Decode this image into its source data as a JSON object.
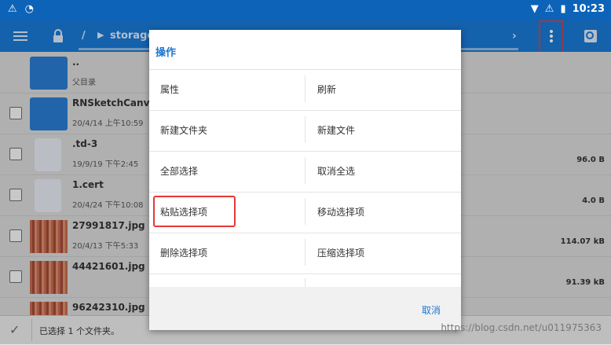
{
  "statusbar": {
    "time": "10:23"
  },
  "toolbar": {
    "path_root": "/",
    "path_segment": "storage"
  },
  "list": {
    "rows": [
      {
        "name": "..",
        "meta": "父目录",
        "size": ""
      },
      {
        "name": "RNSketchCanvas",
        "meta": "20/4/14 上午10:59",
        "size": ""
      },
      {
        "name": ".td-3",
        "meta": "19/9/19 下午2:45",
        "size": "96.0 B"
      },
      {
        "name": "1.cert",
        "meta": "20/4/24 下午10:08",
        "size": "4.0 B"
      },
      {
        "name": "27991817.jpg",
        "meta": "20/4/13 下午5:33",
        "size": "114.07 kB"
      },
      {
        "name": "44421601.jpg",
        "meta": "",
        "size": "91.39 kB"
      },
      {
        "name": "96242310.jpg",
        "meta": "",
        "size": ""
      }
    ]
  },
  "dialog": {
    "title": "操作",
    "actions": [
      [
        "属性",
        "刷新"
      ],
      [
        "新建文件夹",
        "新建文件"
      ],
      [
        "全部选择",
        "取消全选"
      ],
      [
        "粘贴选择项",
        "移动选择项"
      ],
      [
        "删除选择项",
        "压缩选择项"
      ]
    ],
    "cancel": "取消"
  },
  "bottombar": {
    "status": "已选择 1 个文件夹。"
  },
  "watermark": "https://blog.csdn.net/u011975363"
}
